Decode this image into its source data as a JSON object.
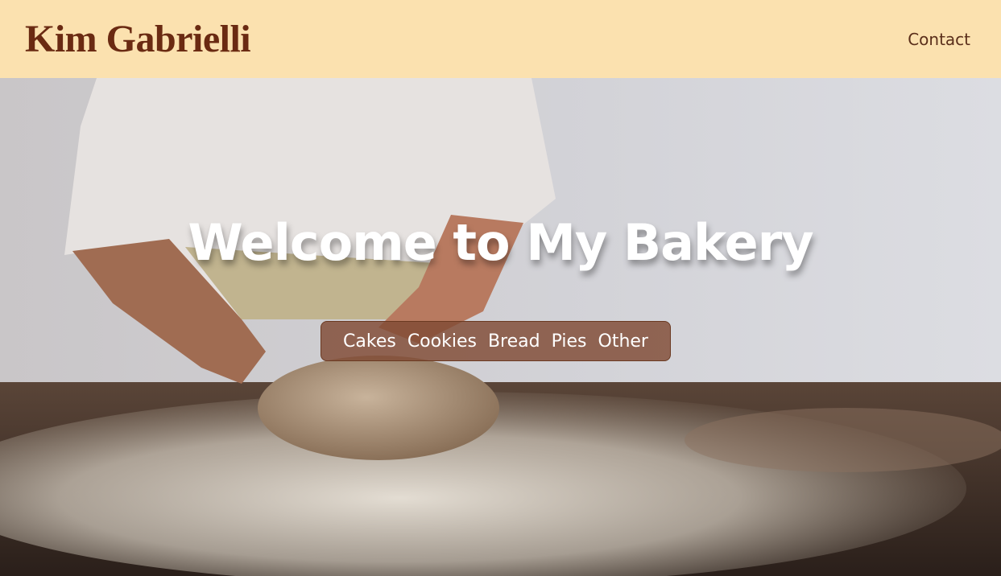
{
  "header": {
    "brand": "Kim Gabrielli",
    "nav": {
      "contact_label": "Contact"
    }
  },
  "hero": {
    "title": "Welcome to My Bakery",
    "categories": [
      "Cakes",
      "Cookies",
      "Bread",
      "Pies",
      "Other"
    ]
  },
  "colors": {
    "header_bg": "#fbe1af",
    "brand_text": "#6a2a12",
    "category_bar_bg": "#804a34"
  }
}
